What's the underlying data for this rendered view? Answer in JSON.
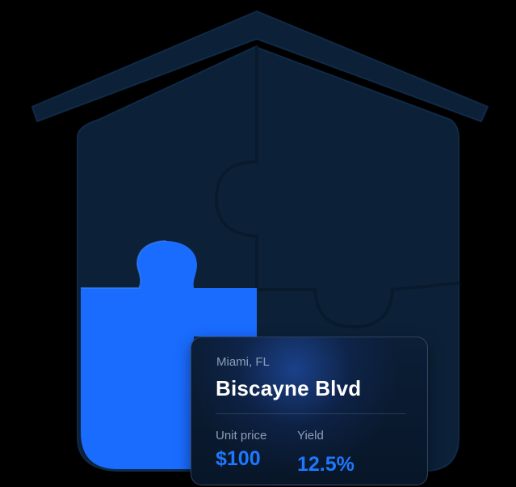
{
  "colors": {
    "house_dark": "#0c2138",
    "house_edge": "#0f2a47",
    "piece_blue": "#1a6cff",
    "card_bg": "#0a1a30",
    "accent_blue": "#1e78ff",
    "muted_text": "#8d9fb8"
  },
  "card": {
    "location": "Miami, FL",
    "title": "Biscayne Blvd",
    "unit_price_label": "Unit price",
    "unit_price_value": "$100",
    "yield_label": "Yield",
    "yield_value": "12.5%"
  }
}
